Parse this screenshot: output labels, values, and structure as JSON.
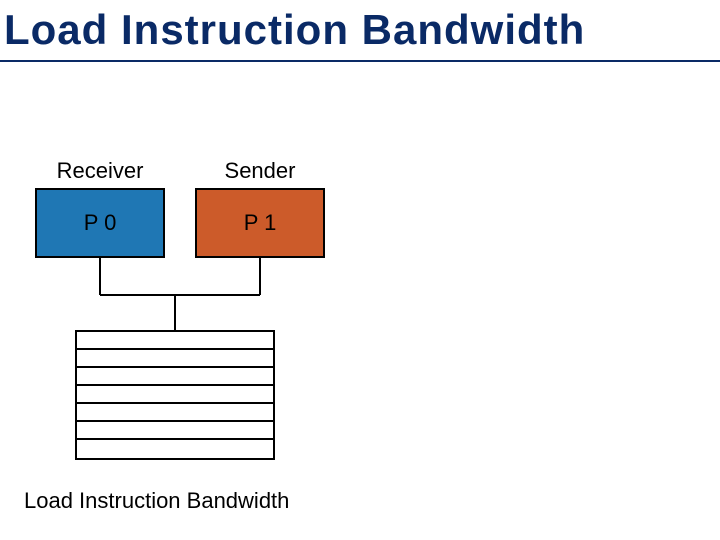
{
  "title": "Load Instruction Bandwidth",
  "labels": {
    "receiver": "Receiver",
    "sender": "Sender"
  },
  "processors": {
    "p0": {
      "label": "P 0",
      "fill": "#1f77b4"
    },
    "p1": {
      "label": "P 1",
      "fill": "#cc5b2a"
    }
  },
  "caption": "Load Instruction Bandwidth",
  "table": {
    "rows": 7
  }
}
